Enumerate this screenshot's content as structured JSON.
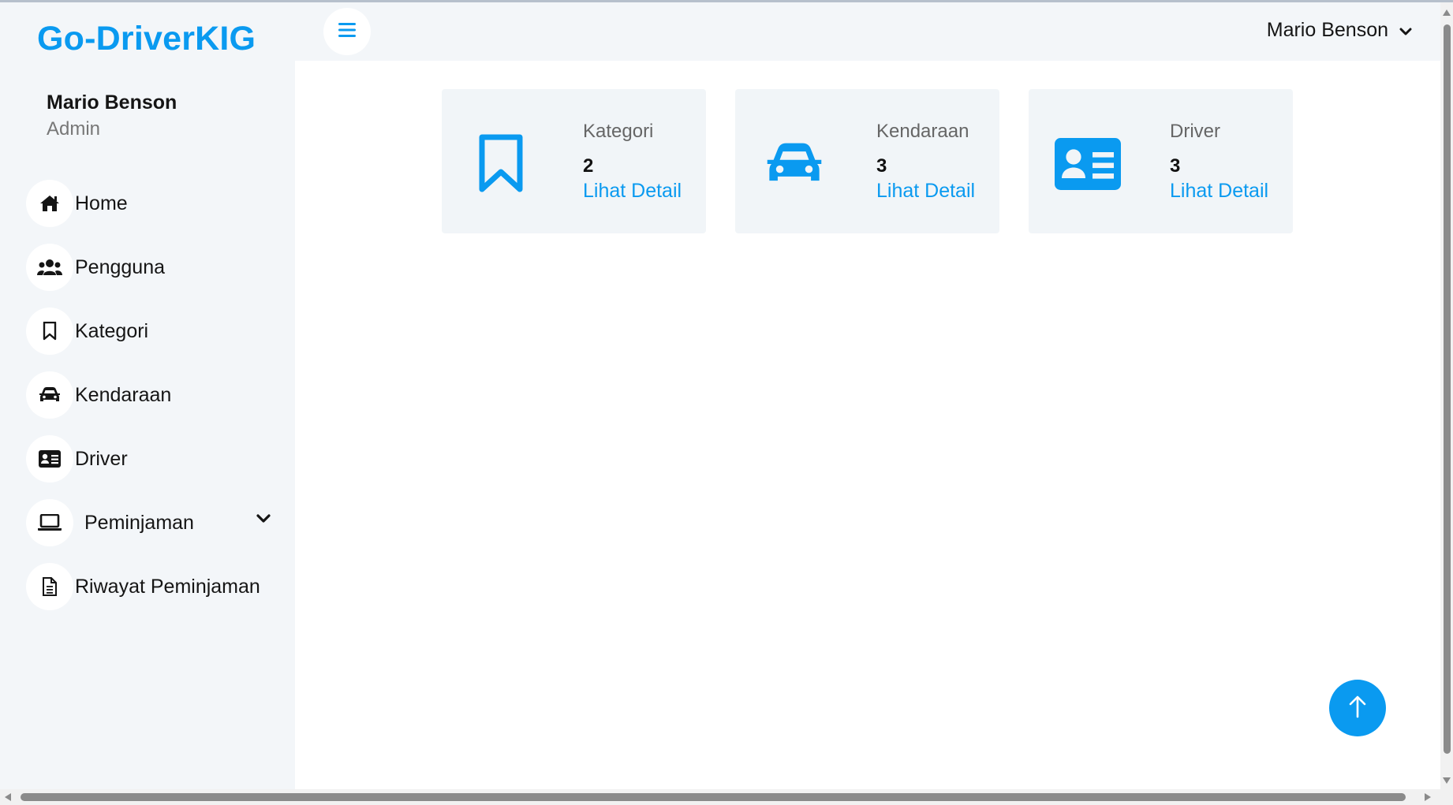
{
  "brand": "Go-DriverKIG",
  "sidebar": {
    "user_name": "Mario Benson",
    "user_role": "Admin",
    "items": [
      {
        "label": "Home",
        "icon": "home-icon"
      },
      {
        "label": "Pengguna",
        "icon": "users-icon"
      },
      {
        "label": "Kategori",
        "icon": "bookmark-icon"
      },
      {
        "label": "Kendaraan",
        "icon": "car-icon"
      },
      {
        "label": "Driver",
        "icon": "id-card-icon"
      },
      {
        "label": "Peminjaman",
        "icon": "laptop-icon"
      },
      {
        "label": "Riwayat Peminjaman",
        "icon": "file-icon"
      }
    ]
  },
  "header": {
    "user_name": "Mario Benson"
  },
  "cards": [
    {
      "title": "Kategori",
      "count": "2",
      "link": "Lihat Detail",
      "icon": "bookmark-icon"
    },
    {
      "title": "Kendaraan",
      "count": "3",
      "link": "Lihat Detail",
      "icon": "car-icon"
    },
    {
      "title": "Driver",
      "count": "3",
      "link": "Lihat Detail",
      "icon": "id-card-icon"
    }
  ],
  "colors": {
    "accent": "#0a9af0",
    "sidebar_bg": "#f3f6f9",
    "card_bg": "#f1f5f8"
  }
}
